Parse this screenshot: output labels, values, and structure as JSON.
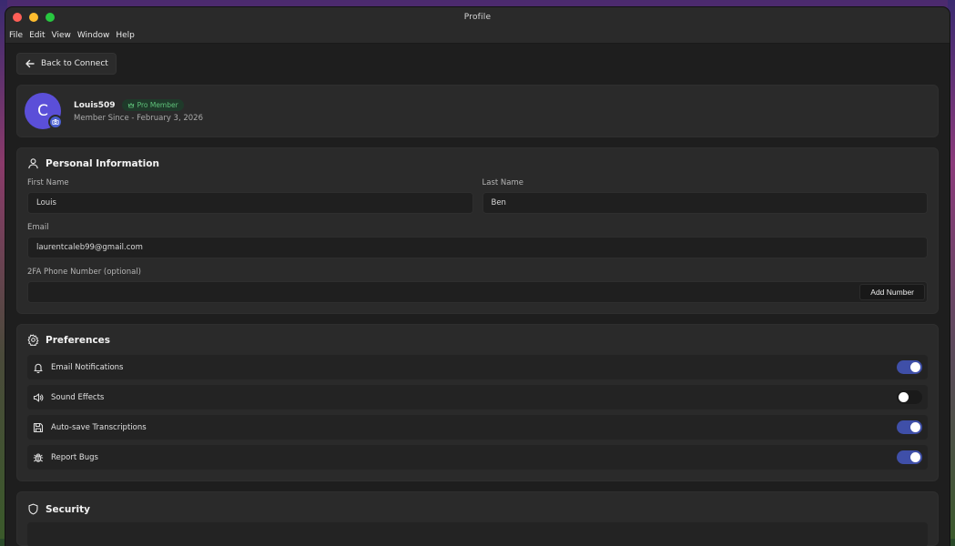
{
  "window": {
    "title": "Profile"
  },
  "menu": [
    "File",
    "Edit",
    "View",
    "Window",
    "Help"
  ],
  "back_label": "Back to Connect",
  "profile": {
    "avatar_letter": "C",
    "username": "Louis509",
    "badge": "Pro Member",
    "member_since": "Member Since - February 3, 2026"
  },
  "personal": {
    "title": "Personal Information",
    "first_name_label": "First Name",
    "first_name": "Louis",
    "last_name_label": "Last Name",
    "last_name": "Ben",
    "email_label": "Email",
    "email": "laurentcaleb99@gmail.com",
    "phone_label": "2FA Phone Number (optional)",
    "phone_value": "",
    "add_number_label": "Add Number"
  },
  "preferences": {
    "title": "Preferences",
    "items": [
      {
        "label": "Email Notifications",
        "icon": "bell-icon",
        "on": true
      },
      {
        "label": "Sound Effects",
        "icon": "speaker-icon",
        "on": false
      },
      {
        "label": "Auto-save Transcriptions",
        "icon": "save-icon",
        "on": true
      },
      {
        "label": "Report Bugs",
        "icon": "bug-icon",
        "on": true
      }
    ]
  },
  "security": {
    "title": "Security"
  },
  "colors": {
    "accent": "#3f4fa8",
    "avatar": "#5b4fd8",
    "pro_badge_text": "#5fc27a"
  }
}
